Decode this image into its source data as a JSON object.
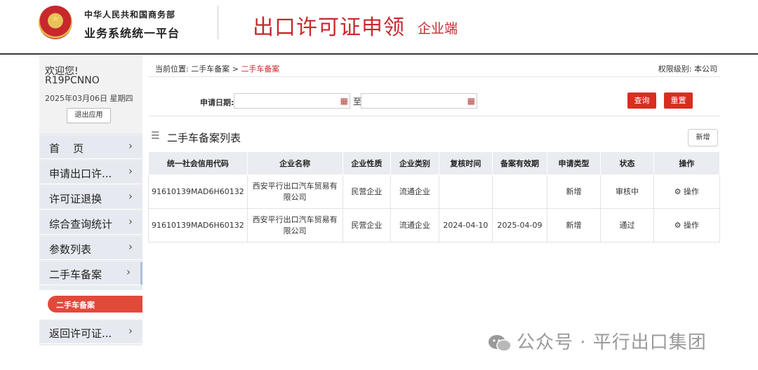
{
  "header": {
    "ministry": "中华人民共和国商务部",
    "platform": "业务系统统一平台",
    "app_title": "出口许可证申领",
    "app_subtitle": "企业端"
  },
  "sidebar": {
    "welcome": "欢迎您!",
    "username": "R19PCNNO",
    "date": "2025年03月06日 星期四",
    "logout": "退出应用",
    "items": [
      {
        "label": "首    页"
      },
      {
        "label": "申请出口许..."
      },
      {
        "label": "许可证退换"
      },
      {
        "label": "综合查询统计"
      },
      {
        "label": "参数列表"
      },
      {
        "label": "二手车备案"
      },
      {
        "label": "返回许可证..."
      }
    ],
    "sub_active": "二手车备案"
  },
  "breadcrumb": {
    "prefix": "当前位置:",
    "level1": "二手车备案",
    "sep": ">",
    "current": "二手车备案"
  },
  "permission": "权限级别: 本公司",
  "filter": {
    "label": "申请日期:",
    "to": "至",
    "query_button": "查询",
    "reset_button": "重置"
  },
  "list": {
    "title": "二手车备案列表",
    "add_button": "新增",
    "columns": [
      "统一社会信用代码",
      "企业名称",
      "企业性质",
      "企业类别",
      "复核时间",
      "备案有效期",
      "申请类型",
      "状态",
      "操作"
    ],
    "rows": [
      [
        "91610139MAD6H60132",
        "西安平行出口汽车贸易有限公司",
        "民营企业",
        "流通企业",
        "",
        "",
        "新增",
        "审核中",
        "操作"
      ],
      [
        "91610139MAD6H60132",
        "西安平行出口汽车贸易有限公司",
        "民营企业",
        "流通企业",
        "2024-04-10",
        "2025-04-09",
        "新增",
        "通过",
        "操作"
      ]
    ]
  },
  "watermark": "公众号 · 平行出口集团",
  "colors": {
    "accent": "#c8282d",
    "button_red": "#d92d20",
    "sidebar_bg": "#e9ecf0"
  }
}
